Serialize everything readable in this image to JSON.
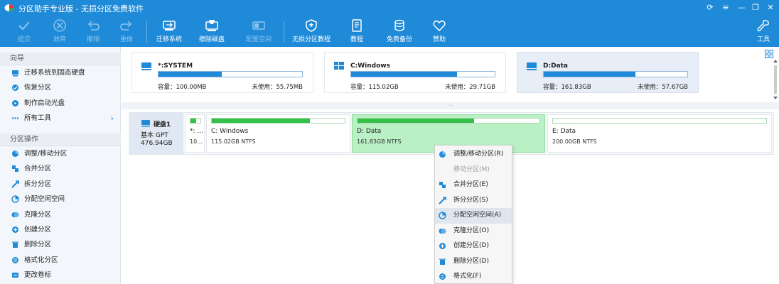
{
  "app": {
    "title": "分区助手专业版 - 无损分区免费软件"
  },
  "toolbar": {
    "items": [
      {
        "label": "提交",
        "icon": "check-icon",
        "enabled": false
      },
      {
        "label": "放弃",
        "icon": "cancel-icon",
        "enabled": false
      },
      {
        "label": "撤销",
        "icon": "undo-icon",
        "enabled": false
      },
      {
        "label": "重做",
        "icon": "redo-icon",
        "enabled": false
      },
      {
        "label": "迁移系统",
        "icon": "migrate-disk-icon",
        "enabled": true
      },
      {
        "label": "擦除磁盘",
        "icon": "wipe-disk-icon",
        "enabled": true
      },
      {
        "label": "配置空间",
        "icon": "allocate-space-icon",
        "enabled": false
      },
      {
        "label": "无损分区教程",
        "icon": "shield-icon",
        "enabled": true
      },
      {
        "label": "教程",
        "icon": "book-icon",
        "enabled": true
      },
      {
        "label": "免费备份",
        "icon": "backup-icon",
        "enabled": true
      },
      {
        "label": "赞助",
        "icon": "heart-icon",
        "enabled": true
      }
    ],
    "tools_label": "工具"
  },
  "sidebar": {
    "wizard_title": "向导",
    "wizard_items": [
      {
        "label": "迁移系统到固态硬盘",
        "icon": "migrate-icon"
      },
      {
        "label": "恢复分区",
        "icon": "recover-icon"
      },
      {
        "label": "制作启动光盘",
        "icon": "bootable-disc-icon"
      },
      {
        "label": "所有工具",
        "icon": "more-icon"
      }
    ],
    "ops_title": "分区操作",
    "ops_items": [
      {
        "label": "调整/移动分区",
        "icon": "resize-icon"
      },
      {
        "label": "合并分区",
        "icon": "merge-icon"
      },
      {
        "label": "拆分分区",
        "icon": "split-icon"
      },
      {
        "label": "分配空闲空间",
        "icon": "allocate-icon"
      },
      {
        "label": "克隆分区",
        "icon": "clone-icon"
      },
      {
        "label": "创建分区",
        "icon": "create-icon"
      },
      {
        "label": "删除分区",
        "icon": "delete-icon"
      },
      {
        "label": "格式化分区",
        "icon": "format-icon"
      },
      {
        "label": "更改卷标",
        "icon": "label-icon"
      }
    ]
  },
  "volumes": [
    {
      "name": "*:SYSTEM",
      "icon": "drive-icon",
      "capacity": "容量：100.00MB",
      "free": "未使用：55.75MB",
      "used_fraction": 0.44,
      "selected": false
    },
    {
      "name": "C:Windows",
      "icon": "windows-icon",
      "capacity": "容量：115.02GB",
      "free": "未使用：29.71GB",
      "used_fraction": 0.74,
      "selected": false
    },
    {
      "name": "D:Data",
      "icon": "drive-icon",
      "capacity": "容量：161.83GB",
      "free": "未使用：57.67GB",
      "used_fraction": 0.64,
      "selected": true
    }
  ],
  "disk": {
    "name": "硬盘1",
    "type": "基本 GPT",
    "size": "476.94GB",
    "partitions": [
      {
        "name": "*: ...",
        "info": "10...",
        "used_fraction": 0.55,
        "selected": false
      },
      {
        "name": "C: Windows",
        "info": "115.02GB NTFS",
        "used_fraction": 0.74,
        "selected": false
      },
      {
        "name": "D: Data",
        "info": "161.83GB NTFS",
        "used_fraction": 0.64,
        "selected": true
      },
      {
        "name": "E: Data",
        "info": "200.00GB NTFS",
        "used_fraction": 0.0,
        "selected": false
      }
    ]
  },
  "context_menu": {
    "items": [
      {
        "label": "调整/移动分区(R)",
        "icon": "resize-icon",
        "enabled": true
      },
      {
        "label": "移动分区(M)",
        "icon": "",
        "enabled": false
      },
      {
        "label": "合并分区(E)",
        "icon": "merge-icon",
        "enabled": true
      },
      {
        "label": "拆分分区(S)",
        "icon": "split-icon",
        "enabled": true
      },
      {
        "label": "分配空闲空间(A)",
        "icon": "allocate-icon",
        "enabled": true
      },
      {
        "label": "克隆分区(O)",
        "icon": "clone-icon",
        "enabled": true
      },
      {
        "label": "创建分区(D)",
        "icon": "create-icon",
        "enabled": true
      },
      {
        "label": "删除分区(D)",
        "icon": "delete-icon",
        "enabled": true
      },
      {
        "label": "格式化(F)",
        "icon": "format-icon",
        "enabled": true
      }
    ]
  },
  "colors": {
    "accent": "#1e8ad8",
    "used_bar": "#1e8ad8",
    "partition_fill": "#35c04a",
    "selected_partition": "#b9f0c4"
  }
}
